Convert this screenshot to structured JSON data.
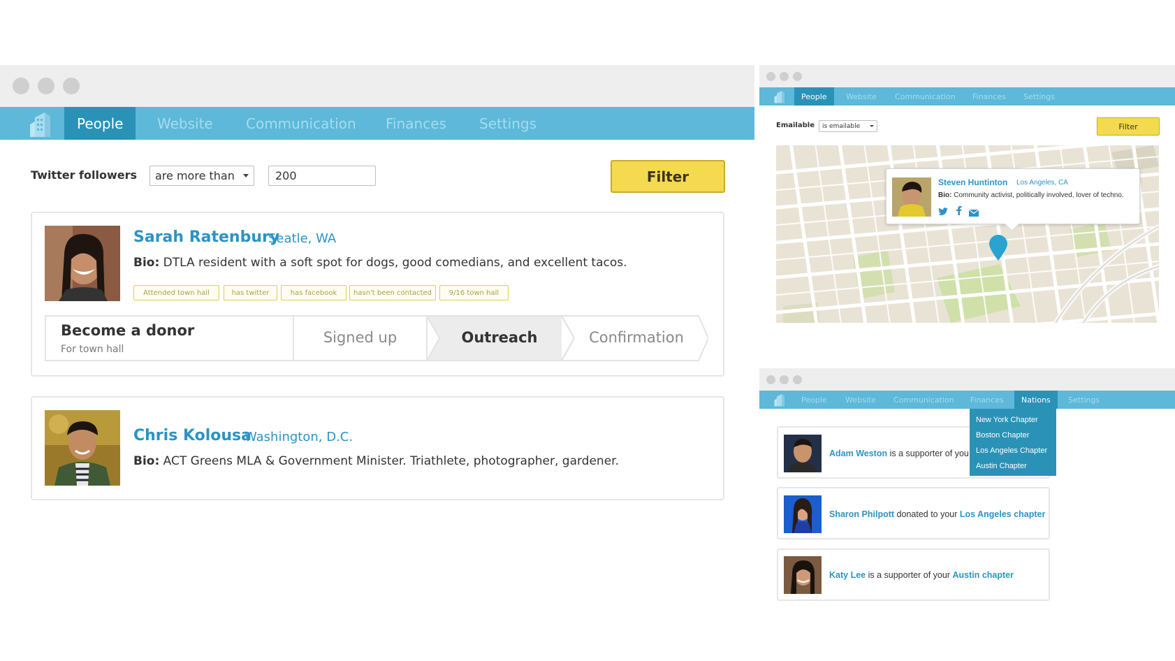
{
  "main_window": {
    "nav": {
      "items": [
        {
          "label": "People",
          "active": true
        },
        {
          "label": "Website",
          "active": false
        },
        {
          "label": "Communication",
          "active": false
        },
        {
          "label": "Finances",
          "active": false
        },
        {
          "label": "Settings",
          "active": false
        }
      ]
    },
    "filter": {
      "field_label": "Twitter followers",
      "operator": "are more than",
      "value": "200",
      "button_label": "Filter"
    },
    "people": [
      {
        "name": "Sarah Ratenbury",
        "location": "Seatle, WA",
        "bio_label": "Bio:",
        "bio": "DTLA resident with a soft spot for dogs, good comedians, and excellent tacos.",
        "tags": [
          "Attended town hall",
          "has twitter",
          "has facebook",
          "hasn't been contacted",
          "9/16 town hall"
        ],
        "pipeline": {
          "title": "Become a donor",
          "subtitle": "For town hall",
          "steps": [
            {
              "label": "Signed up",
              "current": false
            },
            {
              "label": "Outreach",
              "current": true
            },
            {
              "label": "Confirmation",
              "current": false
            }
          ]
        }
      },
      {
        "name": "Chris Kolousa",
        "location": "Washington, D.C.",
        "bio_label": "Bio:",
        "bio": "ACT Greens MLA & Government Minister. Triathlete, photographer, gardener."
      }
    ]
  },
  "map_window": {
    "nav": {
      "items": [
        {
          "label": "People",
          "active": true
        },
        {
          "label": "Website",
          "active": false
        },
        {
          "label": "Communication",
          "active": false
        },
        {
          "label": "Finances",
          "active": false
        },
        {
          "label": "Settings",
          "active": false
        }
      ]
    },
    "filter": {
      "field_label": "Emailable",
      "operator": "is emailable",
      "button_label": "Filter"
    },
    "popup": {
      "name": "Steven Huntinton",
      "location": "Los Angeles, CA",
      "bio_label": "Bio:",
      "bio": "Community activist, politically involved, lover of techno.",
      "social": [
        "twitter-icon",
        "facebook-icon",
        "email-icon"
      ]
    }
  },
  "nations_window": {
    "nav": {
      "items": [
        {
          "label": "People",
          "active": false
        },
        {
          "label": "Website",
          "active": false
        },
        {
          "label": "Communication",
          "active": false
        },
        {
          "label": "Finances",
          "active": false
        },
        {
          "label": "Nations",
          "active": true
        },
        {
          "label": "Settings",
          "active": false
        }
      ]
    },
    "dropdown": [
      "New York Chapter",
      "Boston Chapter",
      "Los Angeles Chapter",
      "Austin Chapter"
    ],
    "feed": [
      {
        "name": "Adam Weston",
        "action": " is a supporter of you",
        "target": ""
      },
      {
        "name": "Sharon Philpott",
        "action": " donated to your ",
        "target": "Los Angeles chapter"
      },
      {
        "name": "Katy Lee",
        "action": " is a supporter of your ",
        "target": "Austin chapter"
      }
    ]
  },
  "colors": {
    "nav_bar": "#5db8d9",
    "nav_active": "#2a92b7",
    "link_blue": "#2b93c5",
    "filter_button": "#f3da4f",
    "tag_border": "#d9cf52"
  }
}
